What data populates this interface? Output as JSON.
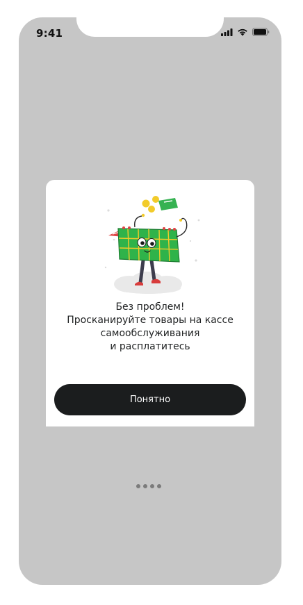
{
  "status_bar": {
    "time": "9:41",
    "icons": [
      "cellular-signal-icon",
      "wifi-icon",
      "battery-icon"
    ]
  },
  "modal": {
    "illustration": "shopping-basket-character",
    "message_lines": [
      "Без проблем!",
      "Просканируйте товары на кассе",
      "самообслуживания",
      "и расплатитесь"
    ],
    "button_label": "Понятно"
  },
  "pager": {
    "dots": 4
  },
  "colors": {
    "backdrop": "#c6c6c6",
    "button": "#1b1d1e",
    "basket_green": "#2fb34a",
    "coin_yellow": "#f2cb2a"
  }
}
